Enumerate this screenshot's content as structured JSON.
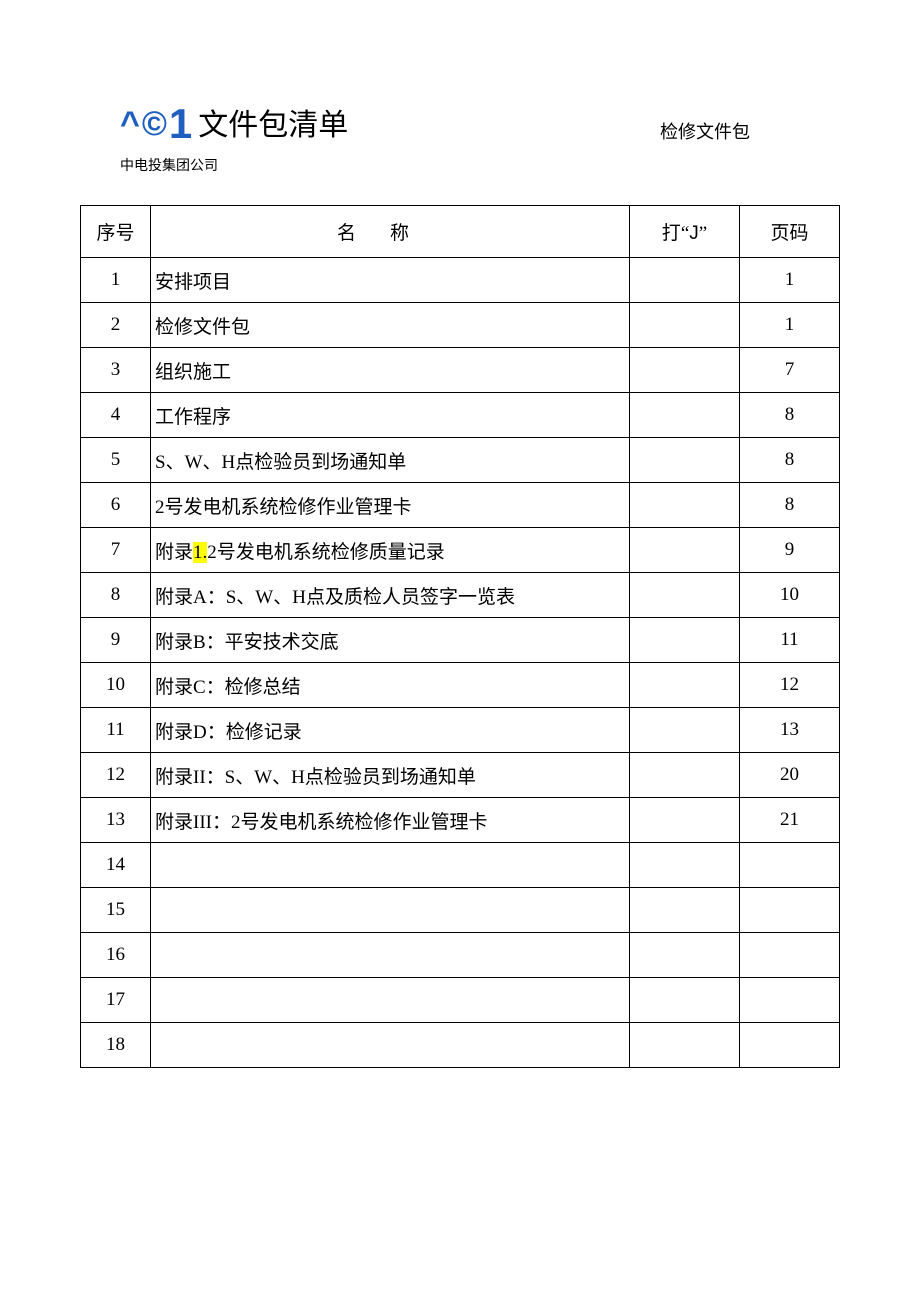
{
  "header": {
    "logo_parts": {
      "caret": "^",
      "copy": "©",
      "one": "1"
    },
    "title": "文件包清单",
    "company": "中电投集团公司",
    "right_label": "检修文件包"
  },
  "table": {
    "headers": {
      "no": "序号",
      "name": "名称",
      "check_prefix": "打",
      "check_quote_open": "“",
      "check_letter": "J",
      "check_quote_close": "”",
      "page": "页码"
    },
    "rows": [
      {
        "no": "1",
        "name_pre": "",
        "name_hl": "",
        "name_post": "安排项目",
        "check": "",
        "page": "1"
      },
      {
        "no": "2",
        "name_pre": "",
        "name_hl": "",
        "name_post": "检修文件包",
        "check": "",
        "page": "1"
      },
      {
        "no": "3",
        "name_pre": "",
        "name_hl": "",
        "name_post": "组织施工",
        "check": "",
        "page": "7"
      },
      {
        "no": "4",
        "name_pre": "",
        "name_hl": "",
        "name_post": "工作程序",
        "check": "",
        "page": "8"
      },
      {
        "no": "5",
        "name_pre": "",
        "name_hl": "",
        "name_post": "S、W、H点检验员到场通知单",
        "check": "",
        "page": "8"
      },
      {
        "no": "6",
        "name_pre": "",
        "name_hl": "",
        "name_post": "2号发电机系统检修作业管理卡",
        "check": "",
        "page": "8"
      },
      {
        "no": "7",
        "name_pre": "附录",
        "name_hl": "1.",
        "name_post": "2号发电机系统检修质量记录",
        "check": "",
        "page": "9"
      },
      {
        "no": "8",
        "name_pre": "",
        "name_hl": "",
        "name_post": "附录A：S、W、H点及质检人员签字一览表",
        "check": "",
        "page": "10"
      },
      {
        "no": "9",
        "name_pre": "",
        "name_hl": "",
        "name_post": "附录B：平安技术交底",
        "check": "",
        "page": "11"
      },
      {
        "no": "10",
        "name_pre": "",
        "name_hl": "",
        "name_post": "附录C：检修总结",
        "check": "",
        "page": "12"
      },
      {
        "no": "11",
        "name_pre": "",
        "name_hl": "",
        "name_post": "附录D：检修记录",
        "check": "",
        "page": "13"
      },
      {
        "no": "12",
        "name_pre": "",
        "name_hl": "",
        "name_post": "附录II：S、W、H点检验员到场通知单",
        "check": "",
        "page": "20"
      },
      {
        "no": "13",
        "name_pre": "",
        "name_hl": "",
        "name_post": "附录III：2号发电机系统检修作业管理卡",
        "check": "",
        "page": "21"
      },
      {
        "no": "14",
        "name_pre": "",
        "name_hl": "",
        "name_post": "",
        "check": "",
        "page": ""
      },
      {
        "no": "15",
        "name_pre": "",
        "name_hl": "",
        "name_post": "",
        "check": "",
        "page": ""
      },
      {
        "no": "16",
        "name_pre": "",
        "name_hl": "",
        "name_post": "",
        "check": "",
        "page": ""
      },
      {
        "no": "17",
        "name_pre": "",
        "name_hl": "",
        "name_post": "",
        "check": "",
        "page": ""
      },
      {
        "no": "18",
        "name_pre": "",
        "name_hl": "",
        "name_post": "",
        "check": "",
        "page": ""
      }
    ]
  }
}
